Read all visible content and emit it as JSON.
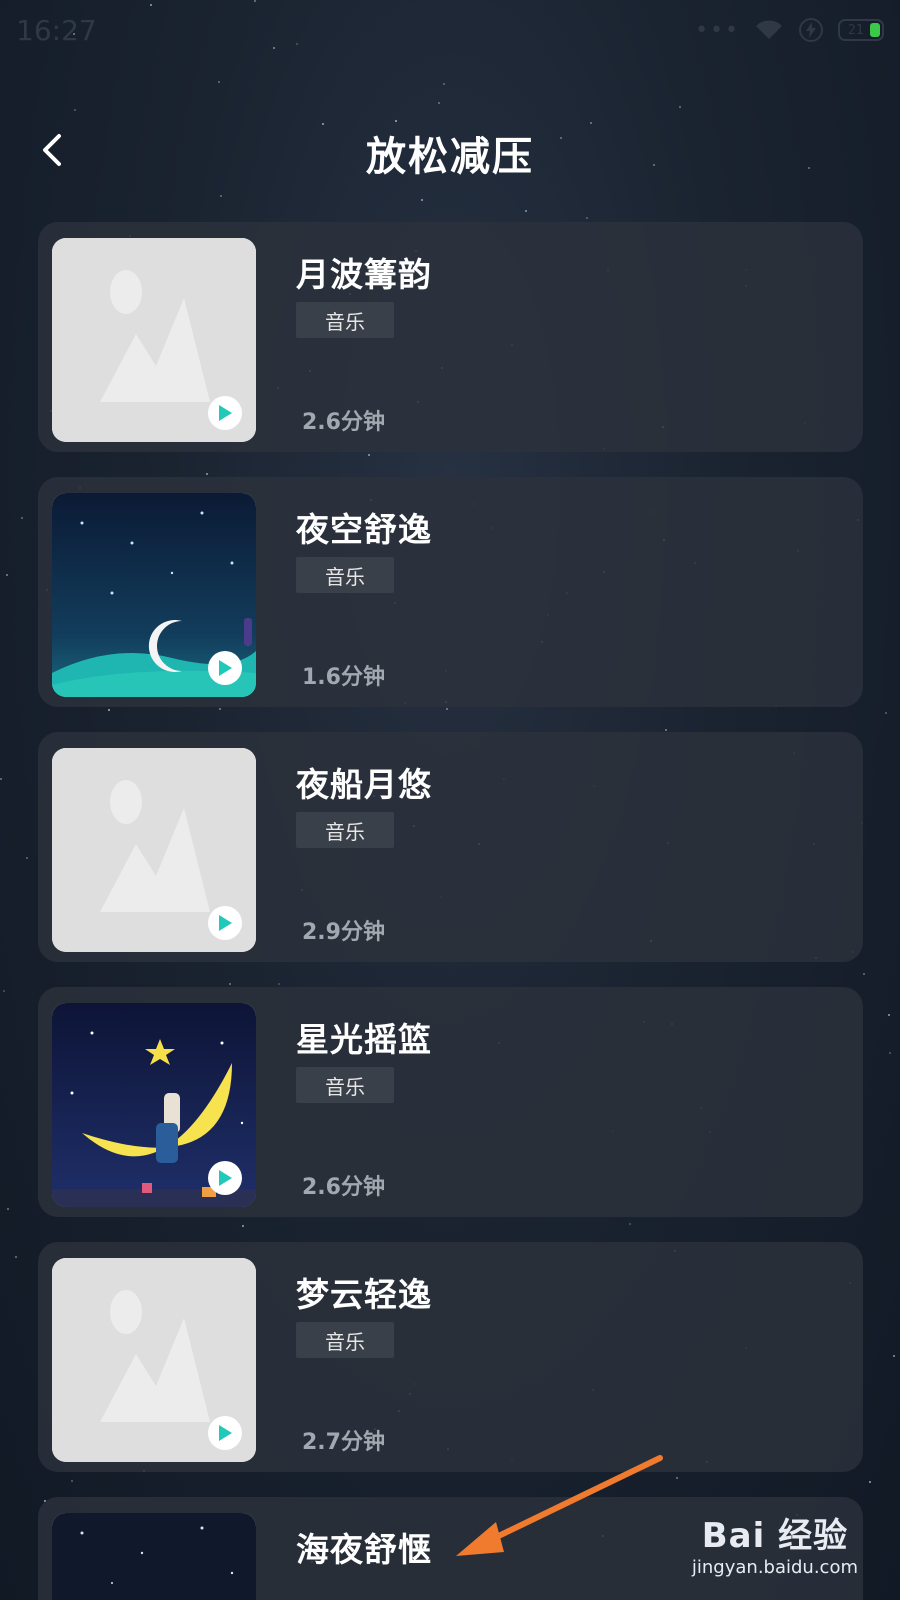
{
  "status_bar": {
    "time": "16:27",
    "signal_dots": "•••",
    "battery_level": "21"
  },
  "header": {
    "title": "放松减压"
  },
  "items": [
    {
      "title": "月波篝韵",
      "tag": "音乐",
      "duration": "2.6分钟",
      "thumbnail": "placeholder-image"
    },
    {
      "title": "夜空舒逸",
      "tag": "音乐",
      "duration": "1.6分钟",
      "thumbnail": "night-sky-moon-image"
    },
    {
      "title": "夜船月悠",
      "tag": "音乐",
      "duration": "2.9分钟",
      "thumbnail": "placeholder-image"
    },
    {
      "title": "星光摇篮",
      "tag": "音乐",
      "duration": "2.6分钟",
      "thumbnail": "crescent-moon-child-image"
    },
    {
      "title": "梦云轻逸",
      "tag": "音乐",
      "duration": "2.7分钟",
      "thumbnail": "placeholder-image"
    },
    {
      "title": "海夜舒惬",
      "tag": "",
      "duration": "",
      "thumbnail": "night-sea-image"
    }
  ],
  "watermark": {
    "logo": "Bai 经验",
    "url": "jingyan.baidu.com"
  },
  "colors": {
    "play_accent": "#21c9b8",
    "arrow": "#f07a2e",
    "battery": "#3cc94a"
  }
}
